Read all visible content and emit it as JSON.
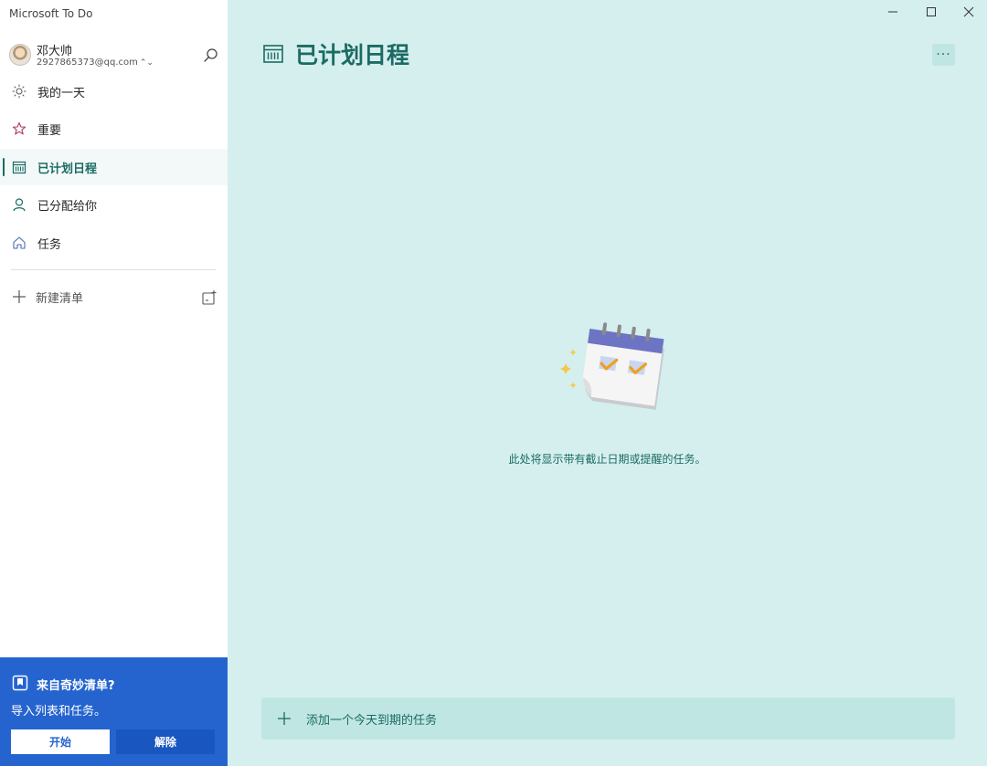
{
  "app": {
    "title": "Microsoft To Do"
  },
  "profile": {
    "name": "邓大帅",
    "email": "2927865373@qq.com",
    "email_chevron": "⌃⌄"
  },
  "sidebar": {
    "items": [
      {
        "label": "我的一天",
        "icon": "sun-icon"
      },
      {
        "label": "重要",
        "icon": "star-icon"
      },
      {
        "label": "已计划日程",
        "icon": "calendar-icon",
        "active": true
      },
      {
        "label": "已分配给你",
        "icon": "person-icon"
      },
      {
        "label": "任务",
        "icon": "home-icon"
      }
    ],
    "new_list_label": "新建清单"
  },
  "promo": {
    "title": "来自奇妙清单?",
    "description": "导入列表和任务。",
    "start_label": "开始",
    "dismiss_label": "解除"
  },
  "main": {
    "title": "已计划日程",
    "more_label": "···",
    "empty_message": "此处将显示带有截止日期或提醒的任务。",
    "add_task_label": "添加一个今天到期的任务"
  },
  "colors": {
    "accent": "#1b6b63",
    "background": "#d5efee",
    "promo": "#2564cf"
  }
}
